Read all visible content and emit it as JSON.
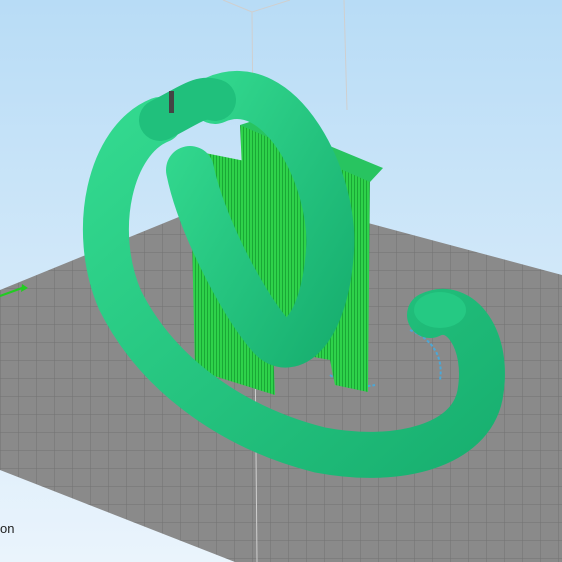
{
  "app": {
    "view_mode_label": "on",
    "colors": {
      "background_top": "#b8dcf6",
      "background_bottom": "#eaf4fc",
      "build_plate": "#8a8a8a",
      "grid_lines": "#707070",
      "model": "#22c57f",
      "support": "#2ed24a",
      "skirt": "#4aa8d8",
      "build_volume": "#d0d0d0"
    },
    "icons": [
      "axis-indicator-icon",
      "nozzle-icon"
    ]
  }
}
